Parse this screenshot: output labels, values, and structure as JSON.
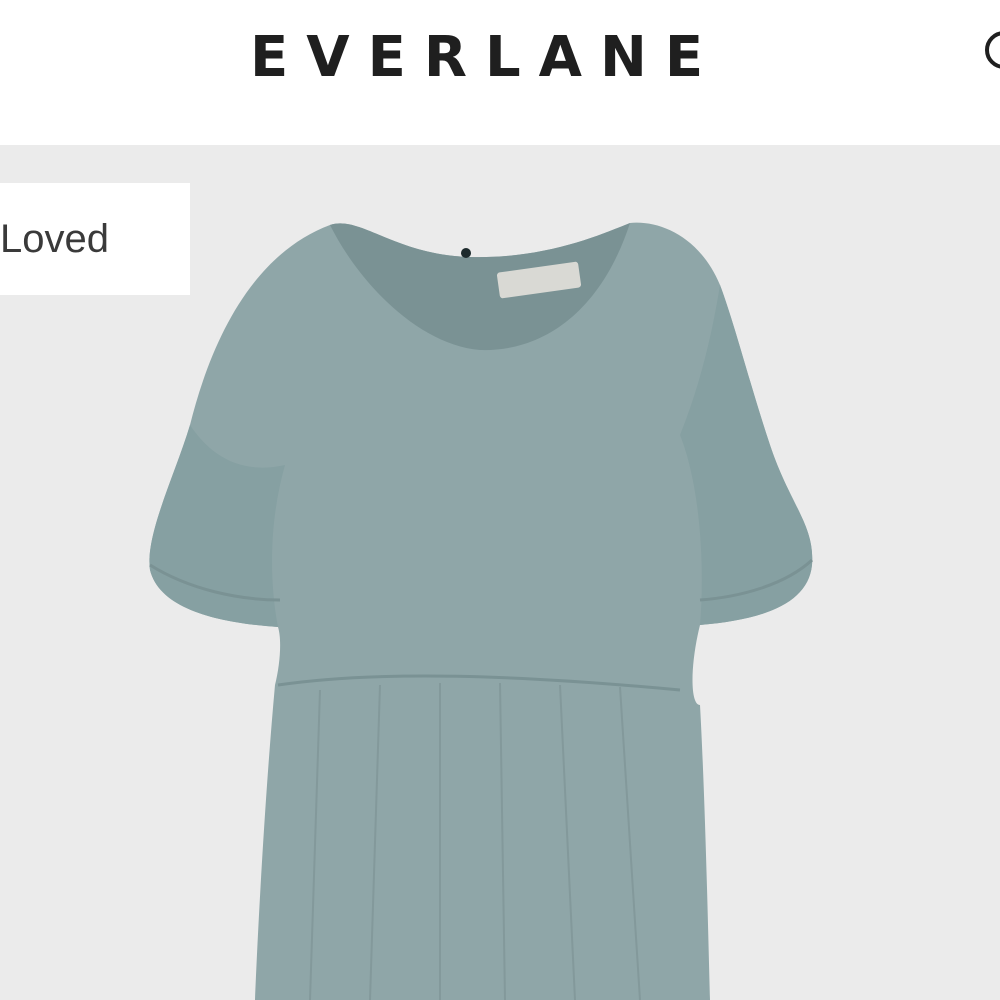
{
  "header": {
    "logo_text": "EVERLANE",
    "search_icon": "search-icon"
  },
  "product": {
    "badge_label": "Loved",
    "image_icon": "dress-image",
    "colors": {
      "background": "#ebebeb",
      "garment": "#8fa6a8",
      "garment_shadow": "#7a9294"
    }
  }
}
